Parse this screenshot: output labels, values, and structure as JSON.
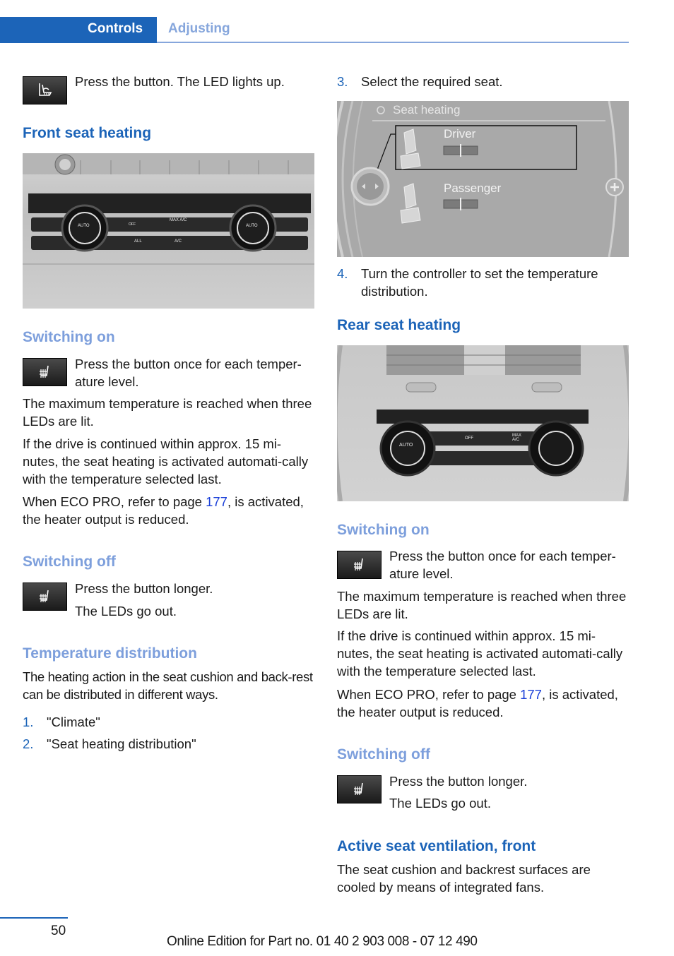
{
  "header": {
    "section": "Controls",
    "subsection": "Adjusting"
  },
  "left": {
    "intro": {
      "icon": "seat-ventilation-icon",
      "text": "Press the button. The LED lights up."
    },
    "front_heading": "Front seat heating",
    "front_figure": {
      "alt": "Front climate control panel",
      "labels": [
        "AUTO",
        "MAX A/C",
        "OFF",
        "ALL",
        "A/C",
        "AUTO"
      ]
    },
    "switching_on": {
      "heading": "Switching on",
      "icon": "seat-heating-icon",
      "text": "Press the button once for each temper-ature level.",
      "p1": "The maximum temperature is reached when three LEDs are lit.",
      "p2": "If the drive is continued within approx. 15 mi-nutes, the seat heating is activated automati-cally with the temperature selected last.",
      "p3_before": "When ECO PRO, refer to page ",
      "p3_link": "177",
      "p3_after": ", is activated, the heater output is reduced."
    },
    "switching_off": {
      "heading": "Switching off",
      "icon": "seat-heating-icon",
      "line1": "Press the button longer.",
      "line2": "The LEDs go out."
    },
    "temp_dist": {
      "heading": "Temperature distribution",
      "text": "The heating action in the seat cushion and back-rest can be distributed in different ways.",
      "steps": [
        {
          "num": "1.",
          "text": "\"Climate\""
        },
        {
          "num": "2.",
          "text": "\"Seat heating distribution\""
        }
      ]
    }
  },
  "right": {
    "step3": {
      "num": "3.",
      "text": "Select the required seat."
    },
    "idrive_figure": {
      "title": "Seat heating",
      "option1": "Driver",
      "option2": "Passenger",
      "driver_distribution": 0.5,
      "passenger_distribution": 0.5
    },
    "step4": {
      "num": "4.",
      "text": "Turn the controller to set the temperature distribution."
    },
    "rear_heading": "Rear seat heating",
    "rear_figure": {
      "alt": "Rear climate control panel",
      "labels": [
        "AUTO",
        "OFF",
        "MAX A/C"
      ]
    },
    "switching_on": {
      "heading": "Switching on",
      "icon": "seat-heating-icon",
      "text": "Press the button once for each temper-ature level.",
      "p1": "The maximum temperature is reached when three LEDs are lit.",
      "p2": "If the drive is continued within approx. 15 mi-nutes, the seat heating is activated automati-cally with the temperature selected last.",
      "p3_before": "When ECO PRO, refer to page ",
      "p3_link": "177",
      "p3_after": ", is activated, the heater output is reduced."
    },
    "switching_off": {
      "heading": "Switching off",
      "icon": "seat-heating-icon",
      "line1": "Press the button longer.",
      "line2": "The LEDs go out."
    },
    "ventilation": {
      "heading": "Active seat ventilation, front",
      "text": "The seat cushion and backrest surfaces are cooled by means of integrated fans."
    }
  },
  "footer": {
    "page_number": "50",
    "edition": "Online Edition for Part no. 01 40 2 903 008 - 07 12 490"
  }
}
